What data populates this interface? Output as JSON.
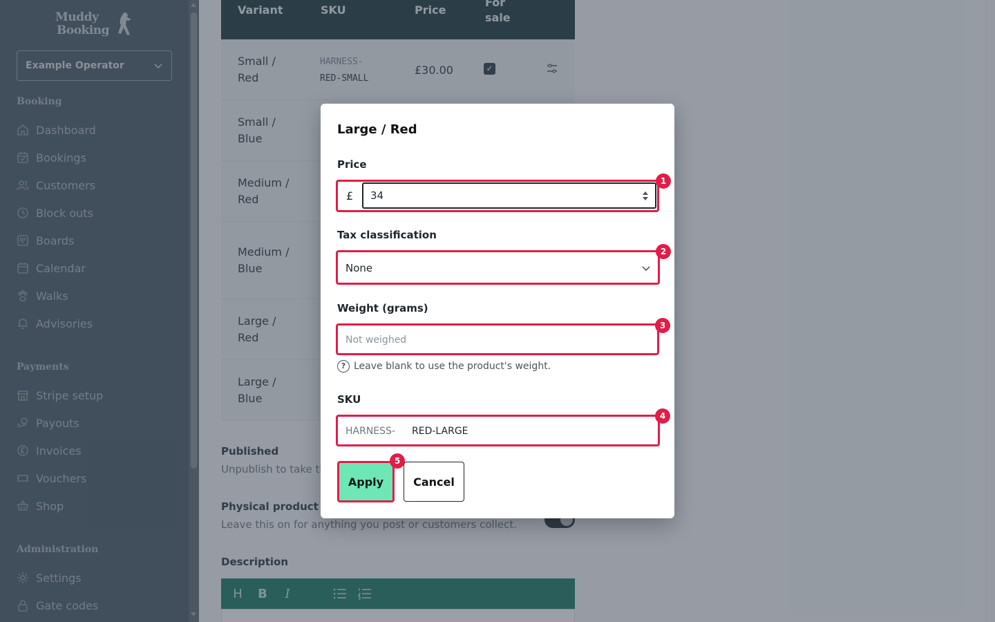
{
  "brand": {
    "logo_line1": "Muddy",
    "logo_line2": "Booking"
  },
  "operator_select": {
    "value": "Example Operator"
  },
  "sidebar": {
    "sections": [
      {
        "title": "Booking",
        "items": [
          {
            "label": "Dashboard",
            "icon": "home-icon"
          },
          {
            "label": "Bookings",
            "icon": "calendar-check-icon"
          },
          {
            "label": "Customers",
            "icon": "users-icon"
          },
          {
            "label": "Block outs",
            "icon": "clock-icon"
          },
          {
            "label": "Boards",
            "icon": "board-icon"
          },
          {
            "label": "Calendar",
            "icon": "calendar-icon"
          },
          {
            "label": "Walks",
            "icon": "paw-icon"
          },
          {
            "label": "Advisories",
            "icon": "bell-icon"
          }
        ]
      },
      {
        "title": "Payments",
        "items": [
          {
            "label": "Stripe setup",
            "icon": "store-icon"
          },
          {
            "label": "Payouts",
            "icon": "payout-icon"
          },
          {
            "label": "Invoices",
            "icon": "pound-coin-icon"
          },
          {
            "label": "Vouchers",
            "icon": "ticket-icon"
          },
          {
            "label": "Shop",
            "icon": "basket-icon"
          }
        ]
      },
      {
        "title": "Administration",
        "items": [
          {
            "label": "Settings",
            "icon": "gear-icon"
          },
          {
            "label": "Gate codes",
            "icon": "lock-icon"
          }
        ]
      }
    ]
  },
  "variants_table": {
    "headers": {
      "variant": "Variant",
      "sku": "SKU",
      "price": "Price",
      "for_sale_1": "For",
      "for_sale_2": "sale"
    },
    "rows": [
      {
        "name_1": "Small /",
        "name_2": "Red",
        "sku_prefix": "HARNESS-",
        "sku": "RED-SMALL",
        "price": "£30.00",
        "for_sale": true
      }
    ],
    "collapsed_rows": [
      {
        "name_1": "Small /",
        "name_2": "Blue"
      },
      {
        "name_1": "Medium /",
        "name_2": "Red"
      },
      {
        "name_1": "Medium /",
        "name_2": "Blue"
      },
      {
        "name_1": "Large /",
        "name_2": "Red"
      },
      {
        "name_1": "Large /",
        "name_2": "Blue"
      }
    ]
  },
  "product_fields": {
    "published_label": "Published",
    "published_help": "Unpublish to take this",
    "physical_label": "Physical product",
    "physical_help": "Leave this on for anything you post or customers collect.",
    "description_label": "Description",
    "editor_tools": [
      "H",
      "B",
      "I"
    ]
  },
  "modal": {
    "title": "Large / Red",
    "price_label": "Price",
    "currency_symbol": "£",
    "price_value": "34",
    "tax_label": "Tax classification",
    "tax_value": "None",
    "weight_label": "Weight (grams)",
    "weight_placeholder": "Not weighed",
    "weight_help": "Leave blank to use the product's weight.",
    "sku_label": "SKU",
    "sku_prefix": "HARNESS-",
    "sku_value": "RED-LARGE",
    "apply_label": "Apply",
    "cancel_label": "Cancel"
  },
  "annotations": [
    "1",
    "2",
    "3",
    "4",
    "5"
  ],
  "colors": {
    "sidebar": "#4a5a64",
    "highlight": "#e11d48",
    "apply": "#6ee7b7",
    "table_header": "#1f3b3f",
    "editor_bar": "#1c7a63"
  }
}
